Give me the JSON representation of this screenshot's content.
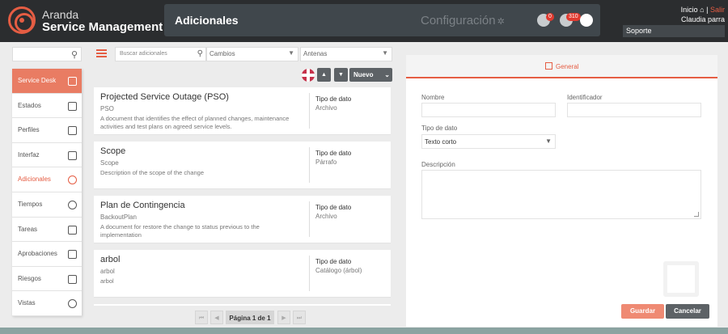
{
  "header": {
    "brand_top": "Aranda",
    "brand_bottom": "Service Management",
    "page_title": "Adicionales",
    "config_label": "Configuración",
    "downloads_count": "0",
    "notifications_count": "310",
    "home_label": "Inicio",
    "logout_label": "Salir",
    "separator": "|",
    "user_name": "Claudia parra",
    "support_value": "Soporte"
  },
  "sidebar": {
    "items": [
      {
        "label": "Service Desk",
        "icon": "copy-icon"
      },
      {
        "label": "Estados",
        "icon": "copy-icon"
      },
      {
        "label": "Perfiles",
        "icon": "badge-icon"
      },
      {
        "label": "Interfaz",
        "icon": "monitor-icon"
      },
      {
        "label": "Adicionales",
        "icon": "plus-circle-icon"
      },
      {
        "label": "Tiempos",
        "icon": "stopwatch-icon"
      },
      {
        "label": "Tareas",
        "icon": "tasks-icon"
      },
      {
        "label": "Aprobaciones",
        "icon": "stamp-icon"
      },
      {
        "label": "Riesgos",
        "icon": "barrier-icon"
      },
      {
        "label": "Vistas",
        "icon": "eye-icon"
      }
    ]
  },
  "toolbar": {
    "search_placeholder": "Buscar adicionales",
    "filter1": "Cambios",
    "filter2": "Antenas",
    "new_label": "Nuevo"
  },
  "list": {
    "type_label": "Tipo de dato",
    "cards": [
      {
        "title": "Projected Service Outage (PSO)",
        "id": "PSO",
        "desc": "A document that identifies the effect of planned changes, maintenance activities and test plans on agreed service levels.",
        "type": "Archivo"
      },
      {
        "title": "Scope",
        "id": "Scope",
        "desc": "Description of the scope of the change",
        "type": "Párrafo"
      },
      {
        "title": "Plan de Contingencia",
        "id": "BackoutPlan",
        "desc": "A document for restore the change to status previous to the implementation",
        "type": "Archivo"
      },
      {
        "title": "arbol",
        "id": "arbol",
        "desc": "arbol",
        "type": "Catálogo (árbol)"
      }
    ]
  },
  "pagination": {
    "label": "Página 1 de 1",
    "first": "⏮",
    "prev": "◀",
    "next": "▶",
    "last": "⏭"
  },
  "form": {
    "tab_label": "General",
    "name_label": "Nombre",
    "identifier_label": "Identificador",
    "datatype_label": "Tipo de dato",
    "datatype_value": "Texto corto",
    "description_label": "Descripción",
    "save_label": "Guardar",
    "cancel_label": "Cancelar"
  },
  "colors": {
    "accent": "#e55d43",
    "header_bg": "#2b2d2f",
    "button_dark": "#5d6266"
  }
}
